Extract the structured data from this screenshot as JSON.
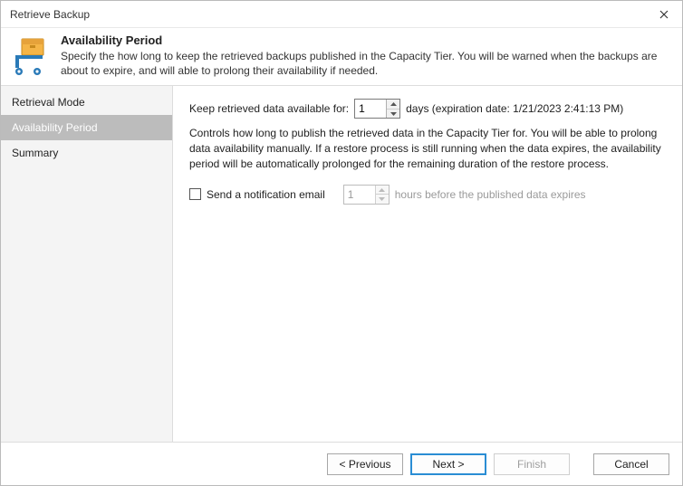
{
  "window": {
    "title": "Retrieve Backup"
  },
  "header": {
    "title": "Availability Period",
    "description": "Specify the how long to keep the retrieved backups published in the Capacity Tier. You will be warned when the backups are about to expire, and will able to prolong their availability if needed."
  },
  "sidebar": {
    "items": [
      {
        "label": "Retrieval Mode",
        "active": false
      },
      {
        "label": "Availability Period",
        "active": true
      },
      {
        "label": "Summary",
        "active": false
      }
    ]
  },
  "content": {
    "keep_label": "Keep retrieved data available for:",
    "keep_value": "1",
    "keep_suffix": "days (expiration date: 1/21/2023 2:41:13 PM)",
    "controls_text": "Controls how long to publish the retrieved data in the Capacity Tier for.  You will be able to prolong data availability manually. If a restore process is still running when the data expires, the availability period will be automatically prolonged for the remaining duration of the restore process.",
    "notify_label": "Send a notification email",
    "notify_checked": false,
    "notify_hours_value": "1",
    "notify_suffix": "hours before the published data expires"
  },
  "footer": {
    "previous": "< Previous",
    "next": "Next >",
    "finish": "Finish",
    "cancel": "Cancel"
  }
}
